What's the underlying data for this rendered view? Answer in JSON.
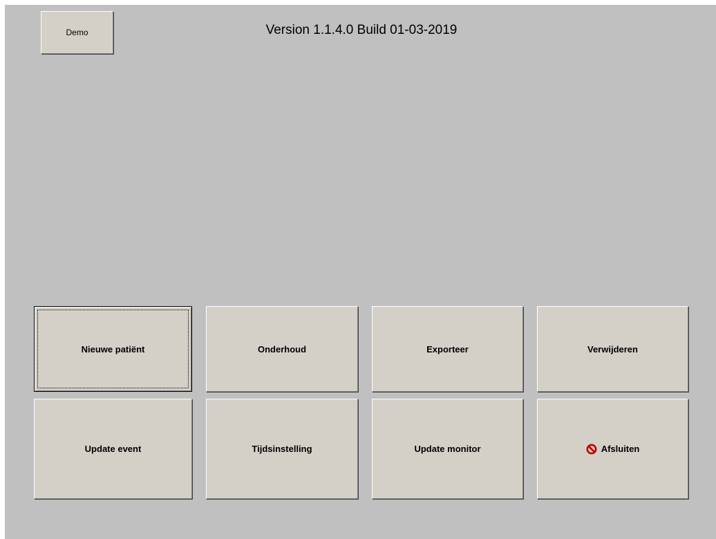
{
  "header": {
    "demo_label": "Demo",
    "version_text": "Version 1.1.4.0 Build 01-03-2019"
  },
  "buttons": {
    "row1": [
      {
        "label": "Nieuwe patiënt"
      },
      {
        "label": "Onderhoud"
      },
      {
        "label": "Exporteer"
      },
      {
        "label": "Verwijderen"
      }
    ],
    "row2": [
      {
        "label": "Update event"
      },
      {
        "label": "Tijdsinstelling"
      },
      {
        "label": "Update monitor"
      },
      {
        "label": "Afsluiten",
        "icon": "stop-icon",
        "icon_color": "#c00000"
      }
    ]
  }
}
